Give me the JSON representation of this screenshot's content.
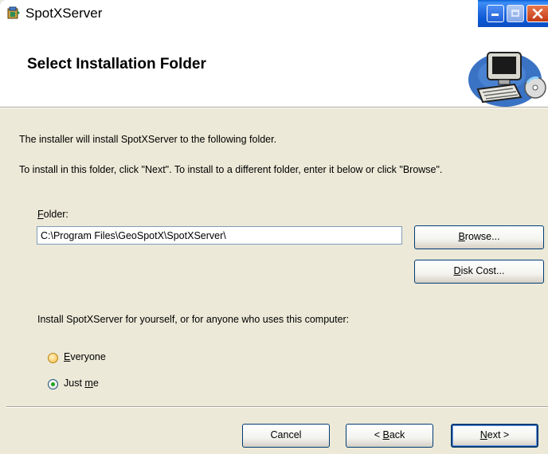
{
  "window": {
    "title": "SpotXServer",
    "controls": [
      "minimize",
      "maximize",
      "close"
    ]
  },
  "header": {
    "title": "Select Installation Folder",
    "art_icon": "computer-with-disc-icon"
  },
  "body": {
    "line1": "The installer will install SpotXServer to the following folder.",
    "line2": "To install in this folder, click \"Next\". To install to a different folder, enter it below or click \"Browse\".",
    "folder_label_accel": "F",
    "folder_label_rest": "older:",
    "folder_value": "C:\\Program Files\\GeoSpotX\\SpotXServer\\",
    "browse_accel": "B",
    "browse_rest": "rowse...",
    "disk_cost_accel": "D",
    "disk_cost_rest": "isk Cost...",
    "install_for_text": "Install SpotXServer for yourself, or for anyone who uses this computer:",
    "option_everyone_accel": "E",
    "option_everyone_rest": "veryone",
    "option_justme_pre": "Just ",
    "option_justme_accel": "m",
    "option_justme_rest": "e",
    "selected_option": "Just me"
  },
  "footer": {
    "cancel_label": "Cancel",
    "back_pre": "< ",
    "back_accel": "B",
    "back_rest": "ack",
    "next_accel": "N",
    "next_rest": "ext >"
  }
}
